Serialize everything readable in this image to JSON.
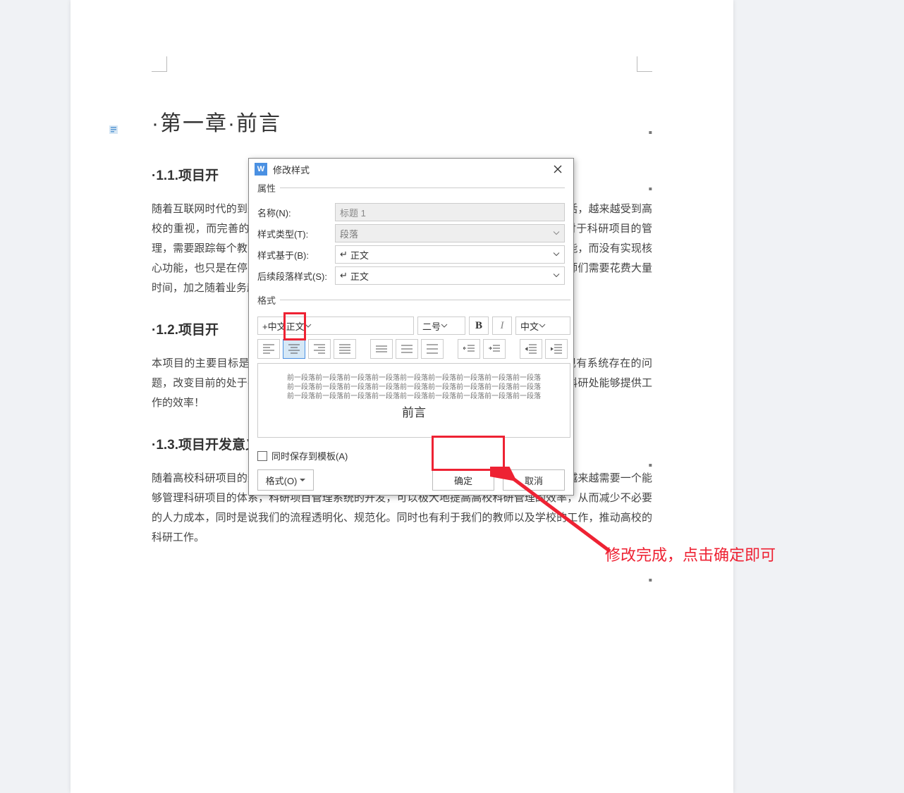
{
  "doc": {
    "chapter_title": "·第一章·前言",
    "h11": "·1.1.项目开",
    "h12": "·1.2.项目开",
    "h13": "·1.3.项目开发意义",
    "p1": "随着互联网时代的到来，各种技术也随之发展，人工智能等技术都参与且改变着我们的生活，越来越受到高校的重视，而完善的科研管理系统对于高校科研管理系统的开发十分必要，我们的教师对于科研项目的管理，需要跟踪每个教师的科研进度，由于各种原因，例如开发商只是开发了数据分享的功能，而没有实现核心功能，也只是在停留在积分的层面。目前，很多高校的科研管理方式效率非常低下，教师们需要花费大量时间，加之随着业务越来越复杂，急需开发一个高校科研管理系统来提升工作效率!",
    "p2": "本项目的主要目标是设计与实现一个基于 B/S 结构的高校科研管理系统，系统解决目前现有系统存在的问题，改变目前的处于手工记录方式，使得高校对于科研的管理能够更加得心应手，让高校科研处能够提供工作的效率！",
    "p3": "随着高校科研项目的逐步规范化，数据的不断提高，复杂性管理的难度都越来越高，高校越来越需要一个能够管理科研项目的体系，科研项目管理系统的开发，可以极大地提高高校科研管理的效率，从而减少不必要的人力成本，同时是说我们的流程透明化、规范化。同时也有利于我们的教师以及学校的工作，推动高校的科研工作。"
  },
  "dialog": {
    "title": "修改样式",
    "grp_props": "属性",
    "lbl_name": "名称(N):",
    "val_name": "标题 1",
    "lbl_type": "样式类型(T):",
    "val_type": "段落",
    "lbl_based": "样式基于(B):",
    "val_based": "正文",
    "lbl_next": "后续段落样式(S):",
    "val_next": "正文",
    "grp_format": "格式",
    "font": "+中文正文",
    "size": "二号",
    "lang": "中文",
    "preview_lines": "前一段落前一段落前一段落前一段落前一段落前一段落前一段落前一段落前一段落",
    "preview_big": "前言",
    "chk_save": "同时保存到模板(A)",
    "btn_format": "格式(O)",
    "btn_ok": "确定",
    "btn_cancel": "取消"
  },
  "annotation": "修改完成，点击确定即可"
}
